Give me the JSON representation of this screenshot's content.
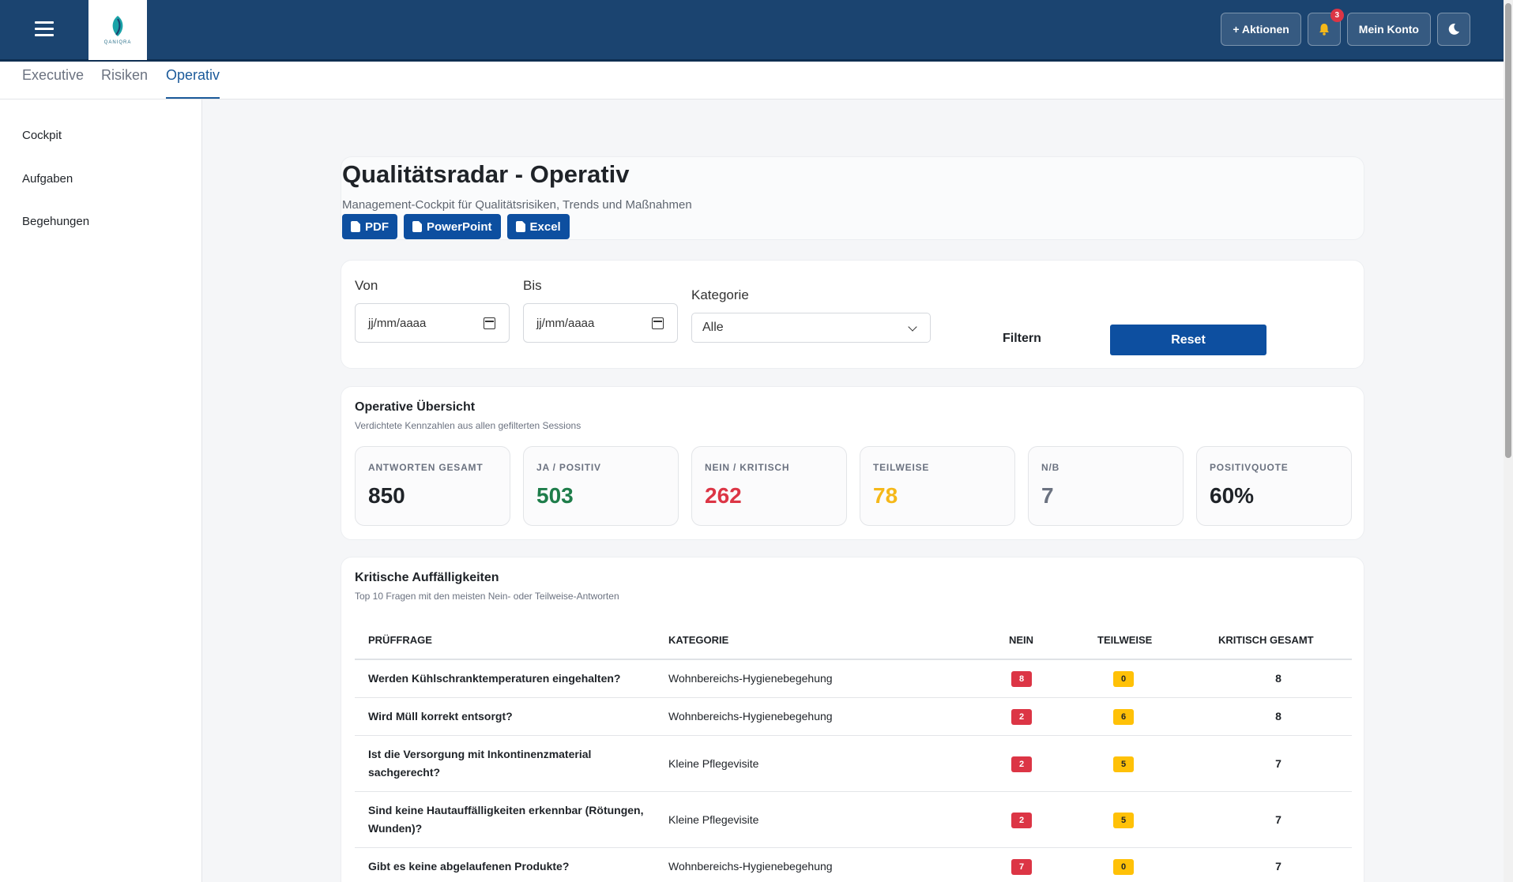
{
  "topbar": {
    "logo_text": "QANIQRA",
    "actions_label": "+ Aktionen",
    "notification_count": "3",
    "account_label": "Mein Konto"
  },
  "tabs": [
    {
      "label": "Executive",
      "active": false
    },
    {
      "label": "Risiken",
      "active": false
    },
    {
      "label": "Operativ",
      "active": true
    }
  ],
  "sidebar": {
    "items": [
      {
        "label": "Cockpit"
      },
      {
        "label": "Aufgaben"
      },
      {
        "label": "Begehungen"
      }
    ]
  },
  "hero": {
    "title": "Qualitätsradar - Operativ",
    "subtitle": "Management-Cockpit für Qualitätsrisiken, Trends und Maßnahmen",
    "export_buttons": [
      {
        "label": "PDF"
      },
      {
        "label": "PowerPoint"
      },
      {
        "label": "Excel"
      }
    ]
  },
  "filters": {
    "from_label": "Von",
    "from_placeholder": "jj/mm/aaaa",
    "to_label": "Bis",
    "to_placeholder": "jj/mm/aaaa",
    "category_label": "Kategorie",
    "category_value": "Alle",
    "filter_label": "Filtern",
    "reset_label": "Reset"
  },
  "overview": {
    "title": "Operative Übersicht",
    "subtitle": "Verdichtete Kennzahlen aus allen gefilterten Sessions",
    "kpis": [
      {
        "label": "ANTWORTEN GESAMT",
        "value": "850",
        "color": "#1f2328"
      },
      {
        "label": "JA / POSITIV",
        "value": "503",
        "color": "#1e7d4a"
      },
      {
        "label": "NEIN / KRITISCH",
        "value": "262",
        "color": "#dc3545"
      },
      {
        "label": "TEILWEISE",
        "value": "78",
        "color": "#f5b819"
      },
      {
        "label": "N/B",
        "value": "7",
        "color": "#6b7280"
      },
      {
        "label": "POSITIVQUOTE",
        "value": "60%",
        "color": "#1f2328"
      }
    ]
  },
  "critical": {
    "title": "Kritische Auffälligkeiten",
    "subtitle": "Top 10 Fragen mit den meisten Nein- oder Teilweise-Antworten",
    "columns": [
      "Prüffrage",
      "Kategorie",
      "Nein",
      "Teilweise",
      "Kritisch gesamt"
    ],
    "rows": [
      {
        "question": "Werden Kühlschranktemperaturen eingehalten?",
        "category": "Wohnbereichs-Hygienebegehung",
        "nein": "8",
        "teilweise": "0",
        "total": "8"
      },
      {
        "question": "Wird Müll korrekt entsorgt?",
        "category": "Wohnbereichs-Hygienebegehung",
        "nein": "2",
        "teilweise": "6",
        "total": "8"
      },
      {
        "question": "Ist die Versorgung mit Inkontinenzmaterial sachgerecht?",
        "category": "Kleine Pflegevisite",
        "nein": "2",
        "teilweise": "5",
        "total": "7"
      },
      {
        "question": "Sind keine Hautauffälligkeiten erkennbar (Rötungen, Wunden)?",
        "category": "Kleine Pflegevisite",
        "nein": "2",
        "teilweise": "5",
        "total": "7"
      },
      {
        "question": "Gibt es keine abgelaufenen Produkte?",
        "category": "Wohnbereichs-Hygienebegehung",
        "nein": "7",
        "teilweise": "0",
        "total": "7"
      }
    ]
  }
}
